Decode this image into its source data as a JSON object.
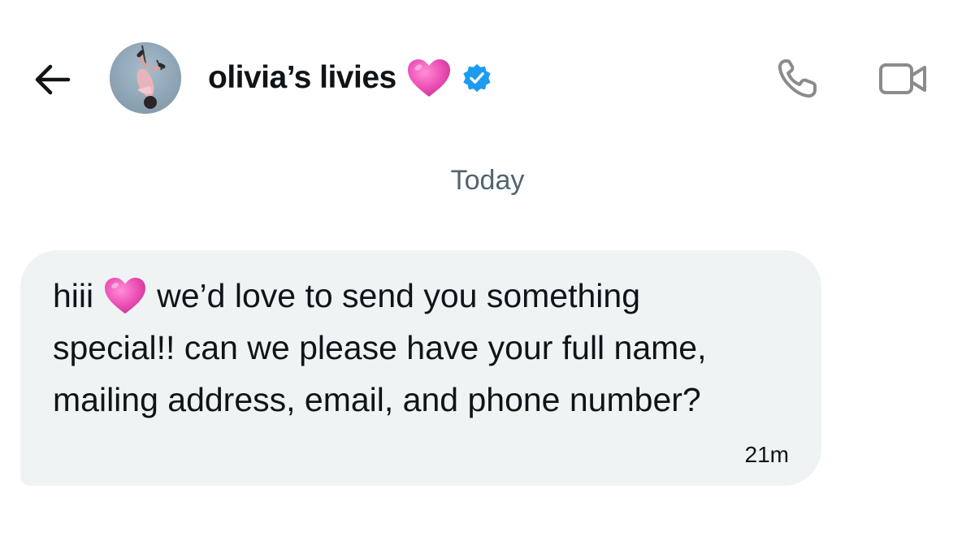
{
  "header": {
    "back_icon": "arrow-left-icon",
    "avatar_alt": "profile photo",
    "title": "olivia’s livies",
    "title_emoji": "pink-heart-icon",
    "verified_icon": "verified-badge-icon",
    "call_icon": "phone-icon",
    "video_icon": "video-camera-icon"
  },
  "conversation": {
    "date_separator": "Today",
    "messages": [
      {
        "line1_start": "hiii",
        "line1_emoji": "pink-heart-icon",
        "line1_end": "we’d love to send you something",
        "line2": "special!! can we please have your full name,",
        "line3": "mailing address, email, and phone number?",
        "timestamp": "21m"
      }
    ]
  },
  "colors": {
    "bubble_bg": "#eff3f4",
    "text": "#0f1419",
    "secondary_text": "#536471",
    "verified_blue": "#1d9bf0",
    "heart_pink": "#e94fb5",
    "icon_gray": "#8b8b8b"
  }
}
